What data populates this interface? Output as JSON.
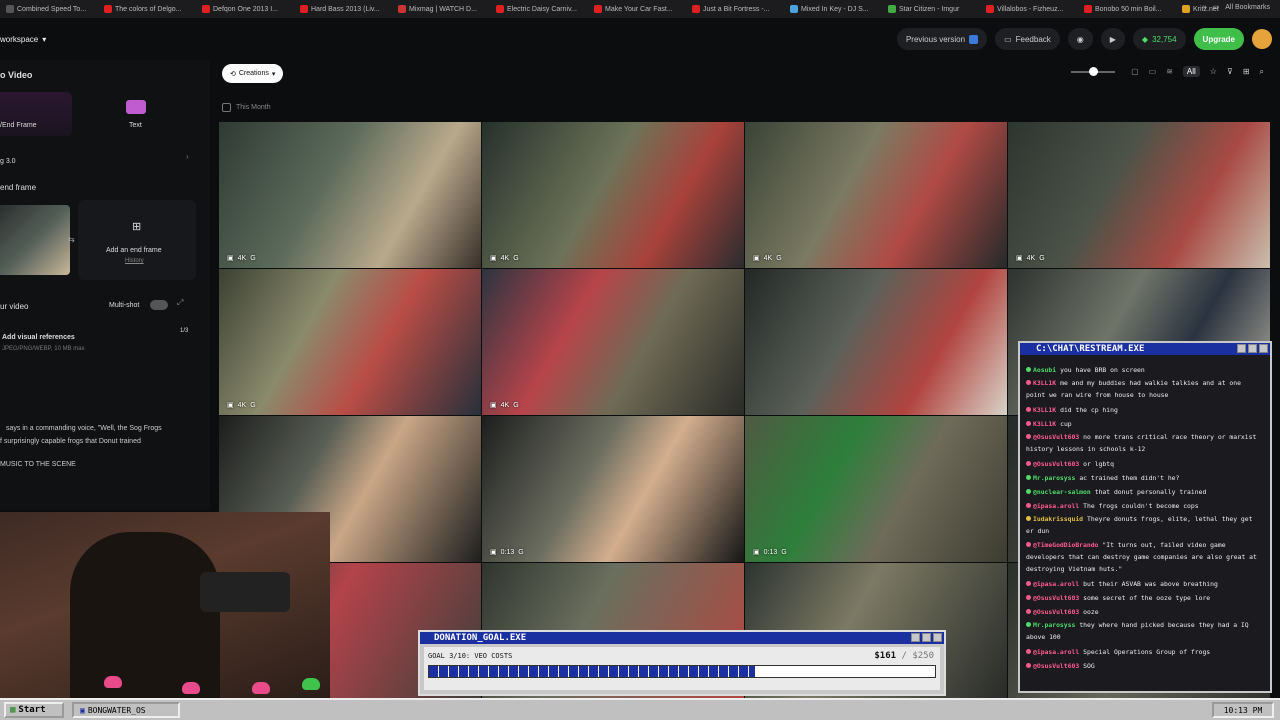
{
  "bookmarks": [
    {
      "label": "Combined Speed To...",
      "color": "#555"
    },
    {
      "label": "The colors of Delgo...",
      "color": "#e02020"
    },
    {
      "label": "Defqon One 2013 I...",
      "color": "#e02020"
    },
    {
      "label": "Hard Bass 2013 (Liv...",
      "color": "#e02020"
    },
    {
      "label": "Mixmag | WATCH D...",
      "color": "#c33"
    },
    {
      "label": "Electric Daisy Carniv...",
      "color": "#e02020"
    },
    {
      "label": "Make Your Car Fast...",
      "color": "#e02020"
    },
    {
      "label": "Just a Bit Fortress -...",
      "color": "#e02020"
    },
    {
      "label": "Mixed In Key - DJ S...",
      "color": "#4aa3df"
    },
    {
      "label": "Star Citizen - Imgur",
      "color": "#4a4"
    },
    {
      "label": "Villalobos - Fizheuz...",
      "color": "#e02020"
    },
    {
      "label": "Bonobo 50 min Boil...",
      "color": "#e02020"
    },
    {
      "label": "Kritz.net",
      "color": "#e0a020"
    }
  ],
  "bookmarks_more": "»",
  "all_bookmarks": "All Bookmarks",
  "header": {
    "workspace": "workspace",
    "previous_version": "Previous version",
    "feedback": "Feedback",
    "credits": "32,754",
    "upgrade": "Upgrade"
  },
  "left": {
    "title": "o Video",
    "tab_frames": "/End Frame",
    "tab_text": "Text",
    "model": "g 3.0",
    "end_frame_heading": "end frame",
    "add_end_frame": "Add an end frame",
    "history": "History",
    "your_video": "ur video",
    "multishot": "Multi-shot",
    "add_visual_refs": "Add visual references",
    "refs_count": "1/3",
    "refs_formats": "JPEG/PNG/WEBP, 10 MB max",
    "prompt_line1": "says in a commanding voice, \"Well, the Sog Frogs",
    "prompt_line2": "f surprisingly capable frogs that Donut trained",
    "prompt_line3": "MUSIC TO THE SCENE"
  },
  "toolbar": {
    "creations": "Creations",
    "all": "All"
  },
  "section": "This Month",
  "tiles": [
    {
      "badge": "4K",
      "bg": "linear-gradient(120deg,#2f3a33,#5b6a5a 40%,#b9a98c 70%,#39302a)"
    },
    {
      "badge": "4K",
      "bg": "linear-gradient(120deg,#26302c,#6d7358 45%,#a8423a 70%,#2a2c2f)"
    },
    {
      "badge": "4K",
      "bg": "linear-gradient(120deg,#3a4336,#7b7a62 40%,#b04a44 65%,#252a2a)"
    },
    {
      "badge": "4K",
      "bg": "linear-gradient(120deg,#2d3530,#4d5348 40%,#a84a43 70%,#c9bfae)"
    },
    {
      "badge": "4K",
      "bg": "linear-gradient(120deg,#3b4032,#8a8a6c 35%,#b94d46 60%,#27303a)"
    },
    {
      "badge": "4K",
      "bg": "linear-gradient(120deg,#2c3440,#b7444a 35%,#6f6b55 60%,#2a2b27)"
    },
    {
      "badge": "",
      "bg": "linear-gradient(120deg,#232826,#5b6159 40%,#b1443f 70%,#d8d3c8)"
    },
    {
      "badge": "",
      "bg": "linear-gradient(120deg,#2e3230,#6f7468 40%,#2a3340 65%,#b8b2a2)"
    },
    {
      "badge": "",
      "bg": "linear-gradient(120deg,#1b1d1c,#5a5f55 35%,#caa686 55%,#1d1f1f)"
    },
    {
      "badge": "0:13",
      "bg": "linear-gradient(120deg,#1c1e1e,#6c6e60 40%,#d4ae8e 60%,#151616)"
    },
    {
      "badge": "0:13",
      "bg": "linear-gradient(120deg,#4f5a42,#2d7f3a 35%,#6f6b5a 60%,#3c3c30)"
    },
    {
      "badge": "",
      "bg": "linear-gradient(120deg,#262a28,#4a4c44 50%,#2a2c2b)"
    },
    {
      "badge": "",
      "bg": "linear-gradient(120deg,#2e3540,#b3434a 40%,#3a3f3a)"
    },
    {
      "badge": "",
      "bg": "linear-gradient(120deg,#2f352e,#6a6f5e 40%,#b6453f)"
    },
    {
      "badge": "",
      "bg": "linear-gradient(120deg,#2c3330,#7c7a64 40%,#252826)"
    },
    {
      "badge": "",
      "bg": "linear-gradient(120deg,#2b2f2a,#64685a 50%,#2e302c)"
    }
  ],
  "chat": {
    "title": "C:\\CHAT\\RESTREAM.EXE",
    "messages": [
      {
        "user": "Aosubi",
        "color": "#4ddb6a",
        "text": "you have BRB on screen"
      },
      {
        "user": "K3LL1K",
        "color": "#ff5b8f",
        "text": "me and my buddies had walkie talkies and at one point we ran wire from house to house"
      },
      {
        "user": "K3LL1K",
        "color": "#ff5b8f",
        "text": "did the cp hing"
      },
      {
        "user": "K3LL1K",
        "color": "#ff5b8f",
        "text": "cup"
      },
      {
        "user": "@OsusVult603",
        "color": "#ff5b8f",
        "text": "no more trans critical race theory or marxist history lessons in schools k-12"
      },
      {
        "user": "@OsusVult603",
        "color": "#ff5b8f",
        "text": "or lgbtq"
      },
      {
        "user": "Mr.parosyss",
        "color": "#4ddb6a",
        "text": "ac trained them didn't he?"
      },
      {
        "user": "@nuclear-salmon",
        "color": "#4ddb6a",
        "text": "that donut personally trained"
      },
      {
        "user": "@ipasa.aroll",
        "color": "#ff5b8f",
        "text": "The frogs couldn't become cops"
      },
      {
        "user": "Iudakrissquid",
        "color": "#e0c040",
        "text": "Theyre donuts frogs, elite, lethal they get er dun"
      },
      {
        "user": "@TimeGodDioBrando",
        "color": "#ff5b8f",
        "text": "\"It turns out, failed video game developers that can destroy game companies are also great at destroying Vietnam huts.\""
      },
      {
        "user": "@ipasa.aroll",
        "color": "#ff5b8f",
        "text": "but their ASVAB was above breathing"
      },
      {
        "user": "@OsusVult603",
        "color": "#ff5b8f",
        "text": "some secret of the ooze type lore"
      },
      {
        "user": "@OsusVult603",
        "color": "#ff5b8f",
        "text": "ooze"
      },
      {
        "user": "Mr.parosyss",
        "color": "#4ddb6a",
        "text": "they where hand picked because they had a IQ above 100"
      },
      {
        "user": "@ipasa.aroll",
        "color": "#ff5b8f",
        "text": "Special Operations Group of frogs"
      },
      {
        "user": "@OsusVult603",
        "color": "#ff5b8f",
        "text": "SOG"
      }
    ]
  },
  "donation": {
    "title": "DONATION_GOAL.EXE",
    "goal": "GOAL 3/10: VEO COSTS",
    "raised": "$161",
    "target": "/ $250",
    "progress": 0.644
  },
  "taskbar": {
    "start": "Start",
    "window": "BONGWATER_OS",
    "clock": "10:13 PM"
  }
}
